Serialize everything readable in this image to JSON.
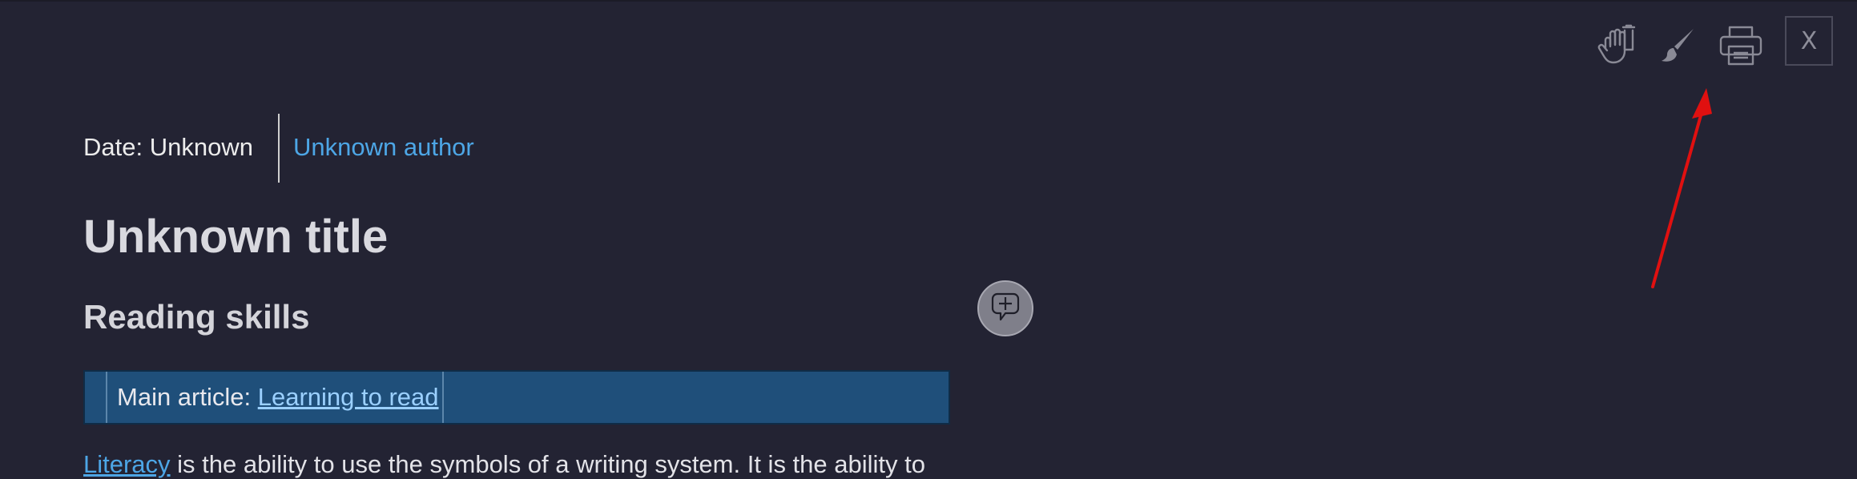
{
  "toolbar": {
    "items": [
      {
        "icon": "hand-icon"
      },
      {
        "icon": "brush-icon"
      },
      {
        "icon": "printer-icon"
      }
    ],
    "close_label": "X"
  },
  "article": {
    "date": "Date: Unknown",
    "author": "Unknown author",
    "title": "Unknown title",
    "section_heading": "Reading skills",
    "hatnote": {
      "prefix": "Main article: ",
      "link": "Learning to read"
    },
    "body": {
      "link": "Literacy",
      "text": " is the ability to use the symbols of a writing system. It is the ability to"
    }
  },
  "comment_button_icon": "add-comment-icon",
  "annotation": {
    "arrow_color": "#e01010"
  },
  "colors": {
    "background": "#232333",
    "link": "#4da6e6",
    "hatnote_background": "#1f4f7a"
  }
}
